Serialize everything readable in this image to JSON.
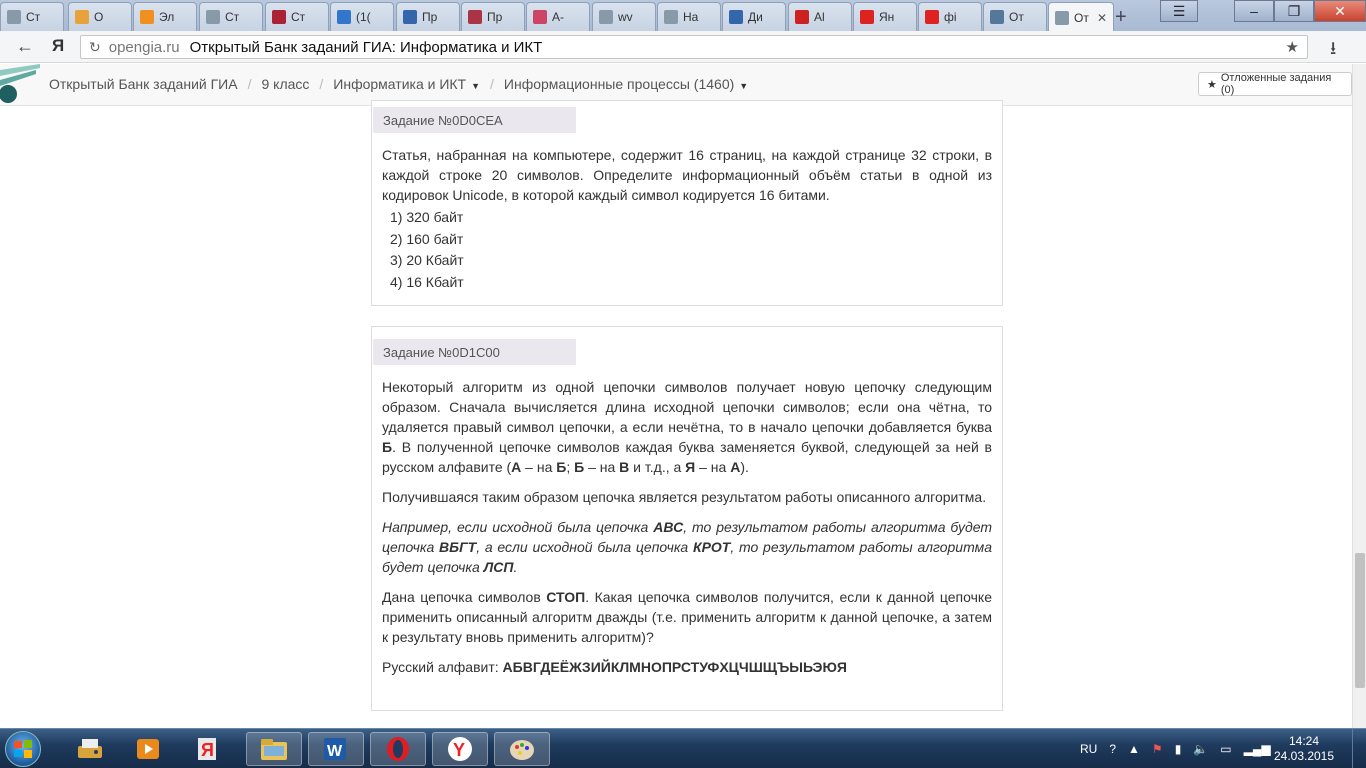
{
  "browser": {
    "tabs": [
      {
        "label": "Ст",
        "icon": "page-icon",
        "color": "#8899aa"
      },
      {
        "label": "О",
        "icon": "joomla-icon",
        "color": "#e8a23c"
      },
      {
        "label": "Эл",
        "icon": "orange-flower-icon",
        "color": "#f09020"
      },
      {
        "label": "Ст",
        "icon": "page-icon",
        "color": "#8899aa"
      },
      {
        "label": "Ст",
        "icon": "book-icon",
        "color": "#aa2233"
      },
      {
        "label": "(1(",
        "icon": "at-icon",
        "color": "#3377cc"
      },
      {
        "label": "Пр",
        "icon": "document-icon",
        "color": "#3366aa"
      },
      {
        "label": "Пр",
        "icon": "pin-icon",
        "color": "#aa3344"
      },
      {
        "label": "А-",
        "icon": "atom-icon",
        "color": "#cc4466"
      },
      {
        "label": "wv",
        "icon": "page-icon",
        "color": "#8899aa"
      },
      {
        "label": "На",
        "icon": "page-icon",
        "color": "#8899aa"
      },
      {
        "label": "Ди",
        "icon": "chat-icon",
        "color": "#3366aa"
      },
      {
        "label": "Al",
        "icon": "cart-icon",
        "color": "#cc2222"
      },
      {
        "label": "Ян",
        "icon": "yandex-icon",
        "color": "#dd2222"
      },
      {
        "label": "фі",
        "icon": "yandex-icon",
        "color": "#dd2222"
      },
      {
        "label": "От",
        "icon": "photo-icon",
        "color": "#557799"
      },
      {
        "label": "От",
        "icon": "page-icon",
        "color": "#8899aa"
      }
    ],
    "domain": "opengia.ru",
    "page_title": "Открытый Банк заданий ГИА: Информатика и ИКТ"
  },
  "site": {
    "breadcrumbs": [
      {
        "label": "Открытый Банк заданий ГИА",
        "dropdown": false
      },
      {
        "label": "9 класс",
        "dropdown": false
      },
      {
        "label": "Информатика и ИКТ",
        "dropdown": true
      },
      {
        "label": "Информационные процессы (1460)",
        "dropdown": true
      }
    ],
    "deferred_label": "Отложенные задания (0)"
  },
  "tasks": [
    {
      "id_label": "Задание №0D0CEA",
      "text": "Статья, набранная на компьютере, содержит 16 страниц, на каждой странице 32 строки, в каждой строке 20 символов. Определите информационный объём статьи в одной из кодировок Unicode, в которой каждый символ кодируется 16 битами.",
      "options": [
        "1) 320 байт",
        "2) 160 байт",
        "3) 20 Кбайт",
        "4) 16 Кбайт"
      ]
    },
    {
      "id_label": "Задание №0D1C00",
      "p1": {
        "a": "Некоторый алгоритм из одной цепочки символов получает новую цепочку следующим образом. Сначала вычисляется длина исходной цепочки символов; если она чётна, то удаляется правый символ цепочки, а если нечётна, то в начало цепочки добавляется буква ",
        "b1": "Б",
        "c": ". В полученной цепочке символов каждая буква заменяется буквой, следующей за ней в русском алфавите (",
        "b2": "А",
        "d": " – на ",
        "b3": "Б",
        "e": "; ",
        "b4": "Б",
        "f": " – на ",
        "b5": "В",
        "g": " и т.д., а ",
        "b6": "Я",
        "h": " – на ",
        "b7": "А",
        "i": ")."
      },
      "p2": "Получившаяся таким образом цепочка является результатом работы описанного алгоритма.",
      "p3": {
        "a": "Например, если исходной была цепочка ",
        "b1": "АВС",
        "c": ", то результатом работы алгоритма будет цепочка ",
        "b2": "ВБГТ",
        "d": ", а если исходной была цепочка ",
        "b3": "КРОТ",
        "e": ", то результатом работы алгоритма будет цепочка ",
        "b4": "ЛСП",
        "f": "."
      },
      "p4": {
        "a": "Дана цепочка символов ",
        "b1": "СТОП",
        "c": ". Какая цепочка символов получится, если к данной цепочке применить описанный алгоритм дважды (т.е. применить алгоритм к данной цепочке, а затем к результату вновь применить алгоритм)?"
      },
      "p5": {
        "a": "Русский алфавит: ",
        "b1": "АБВГДЕЁЖЗИЙКЛМНОПРСТУФХЦЧШЩЪЫЬЭЮЯ"
      }
    }
  ],
  "taskbar": {
    "apps": [
      "start-orb",
      "fax-icon",
      "media-player-icon",
      "yandex-browser-icon",
      "file-explorer-icon",
      "word-icon",
      "opera-icon",
      "yandex-icon",
      "paint-icon"
    ],
    "lang": "RU",
    "time": "14:24",
    "date": "24.03.2015"
  },
  "colors": {
    "task_header_bg": "#ebe7ee",
    "taskbar": "#1f3b5e"
  }
}
